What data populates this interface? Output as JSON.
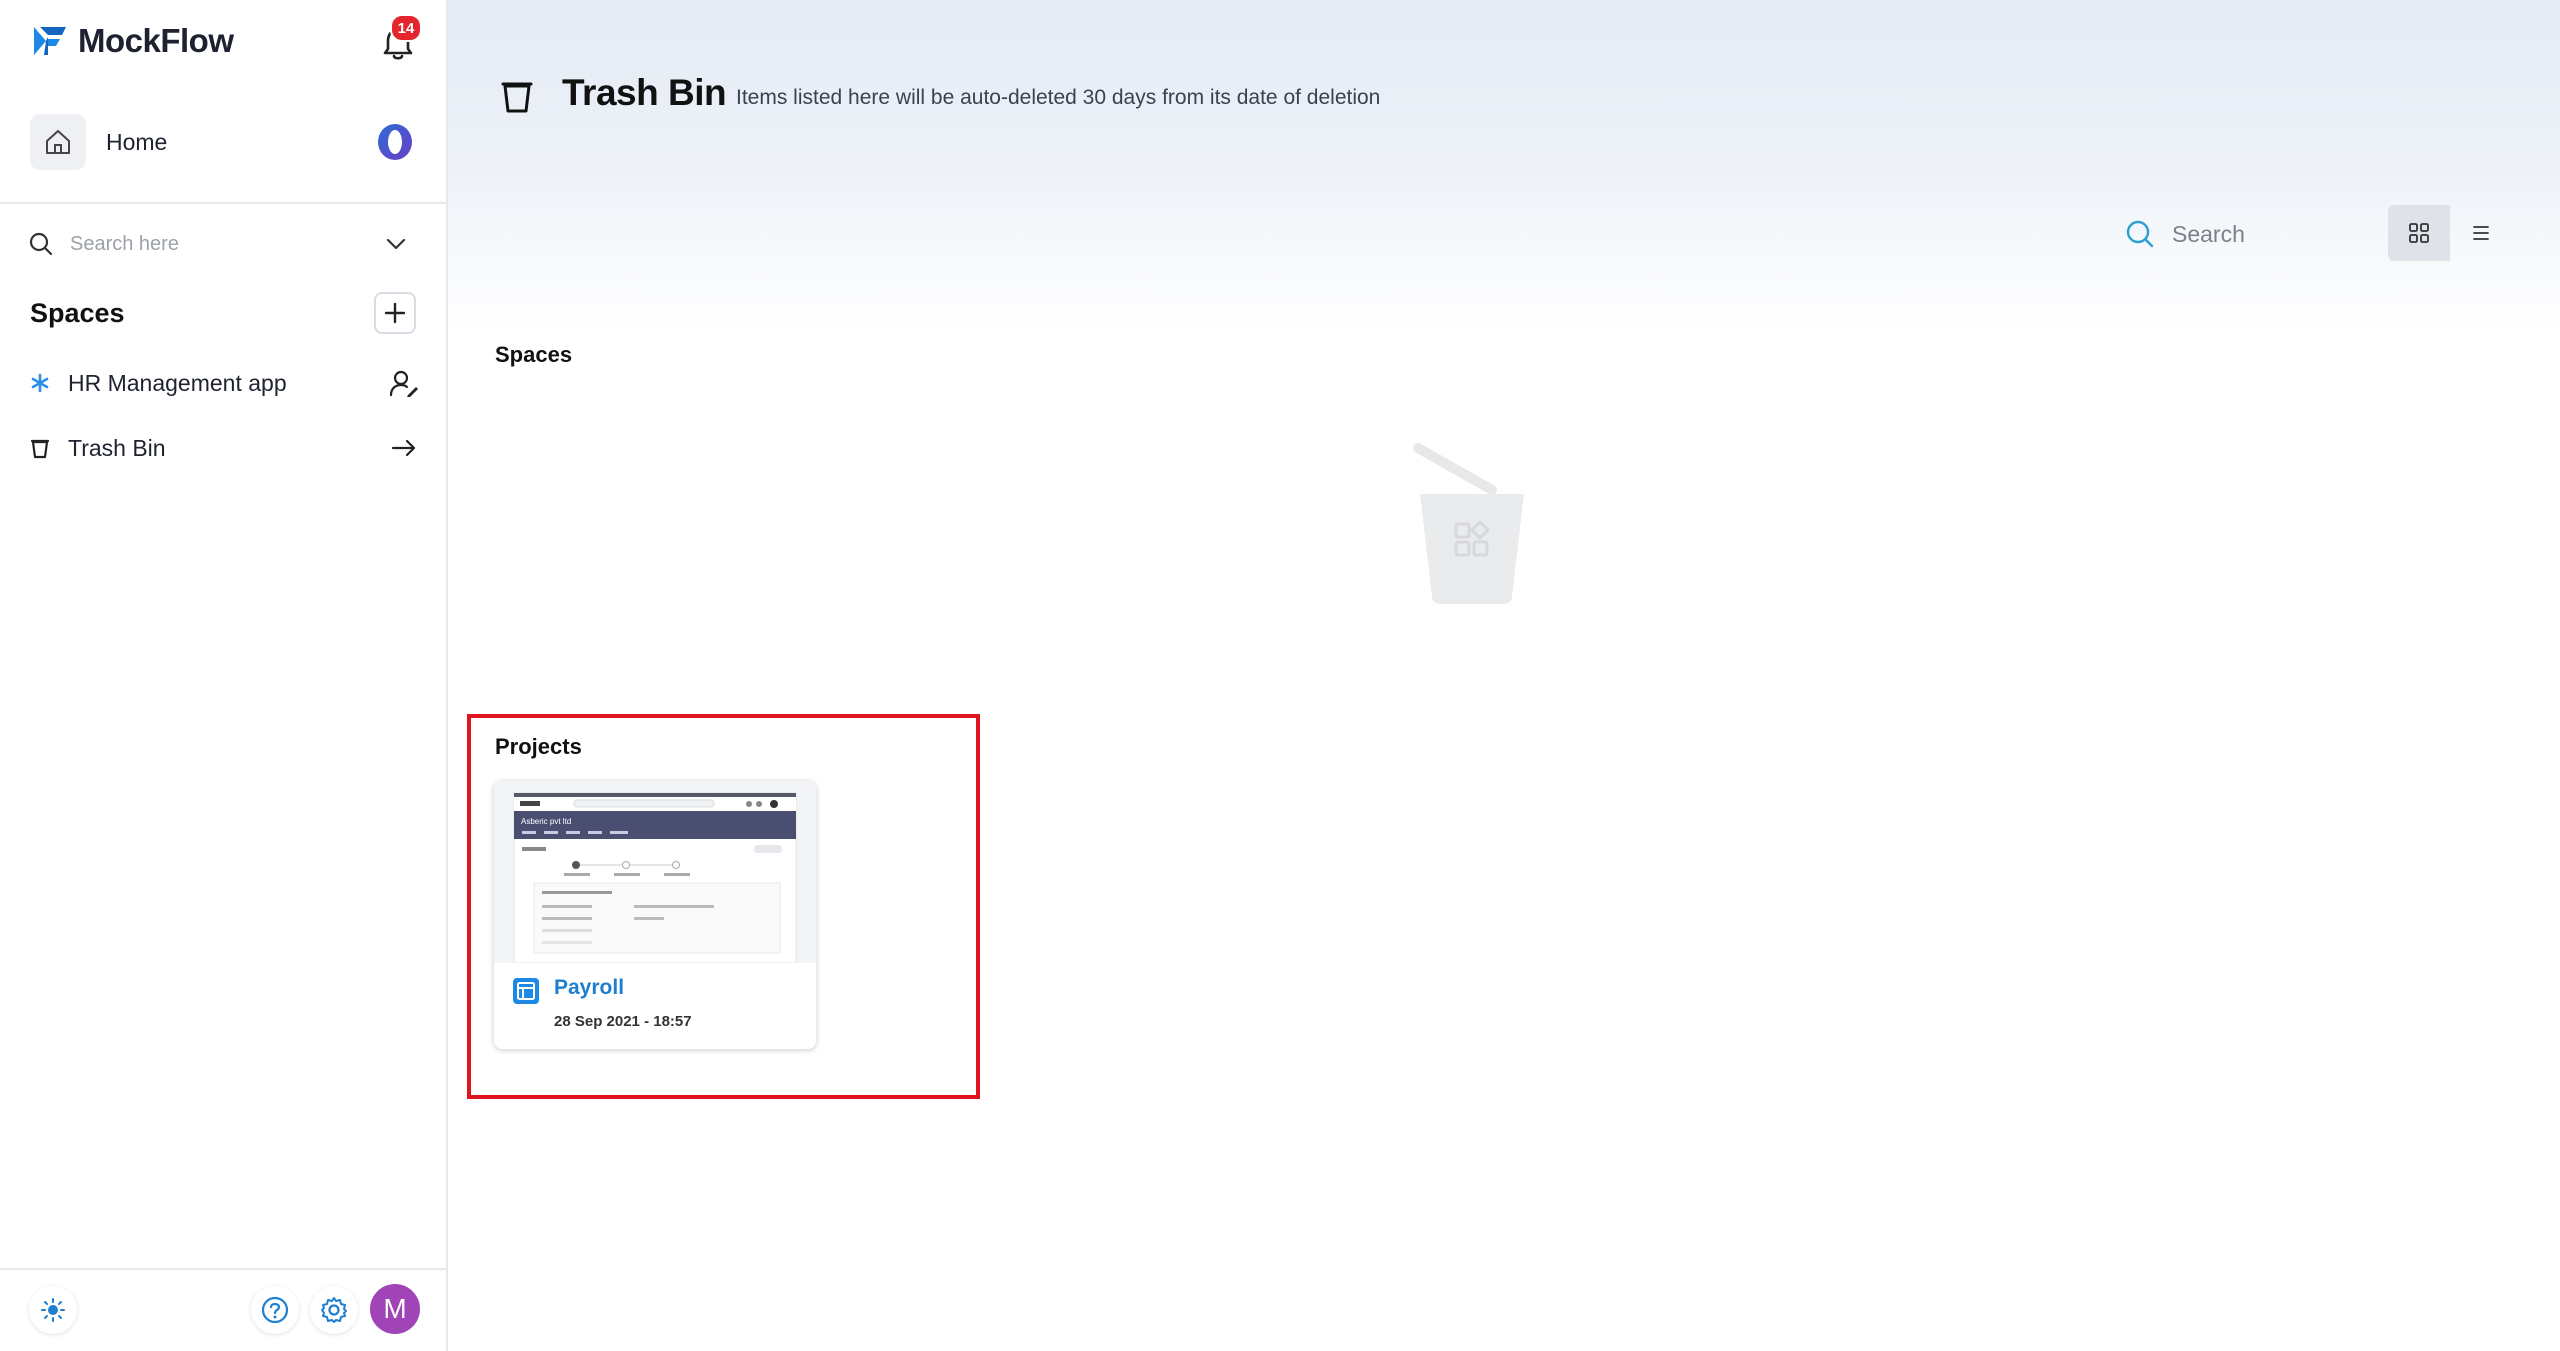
{
  "app": {
    "name": "MockFlow",
    "notification_count": "14"
  },
  "sidebar": {
    "home_label": "Home",
    "search_placeholder": "Search here",
    "spaces_title": "Spaces",
    "items": [
      {
        "label": "HR Management app",
        "icon": "asterisk-icon",
        "trail_icon": "user-edit-icon"
      },
      {
        "label": "Trash Bin",
        "icon": "trash-icon",
        "trail_icon": "arrow-right-icon"
      }
    ],
    "footer": {
      "avatar_letter": "M"
    }
  },
  "header": {
    "title": "Trash Bin",
    "subtitle": "Items listed here will be auto-deleted 30 days from its date of deletion"
  },
  "toolbar": {
    "search_placeholder": "Search",
    "view_mode": "grid"
  },
  "sections": {
    "spaces_title": "Spaces",
    "projects_title": "Projects"
  },
  "projects": [
    {
      "title": "Payroll",
      "date": "28 Sep 2021 - 18:57",
      "thumb_header": "Asberic pvt ltd"
    }
  ],
  "colors": {
    "accent": "#1e7fd0",
    "badge": "#e3262d",
    "avatar": "#a044b8",
    "highlight": "#e0141e"
  }
}
